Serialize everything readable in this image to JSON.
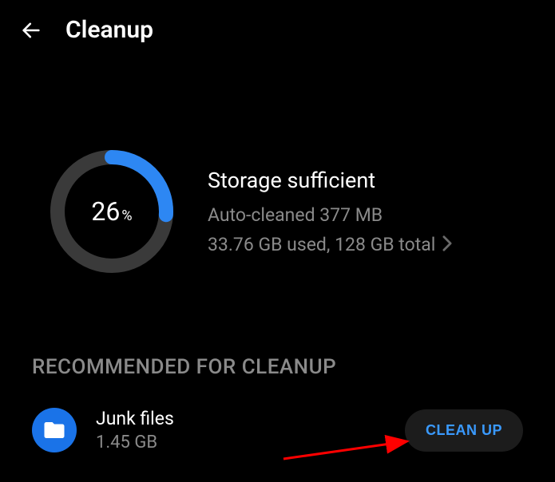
{
  "header": {
    "title": "Cleanup"
  },
  "storage": {
    "percentage": "26",
    "percent_symbol": "%",
    "status_title": "Storage sufficient",
    "auto_cleaned": "Auto-cleaned 377 MB",
    "usage_detail": "33.76 GB used, 128 GB total",
    "ring_color": "#2d87f3",
    "ring_bg": "#3a3a3a"
  },
  "recommended": {
    "section_label": "RECOMMENDED FOR CLEANUP",
    "items": [
      {
        "title": "Junk files",
        "size": "1.45 GB",
        "action_label": "CLEAN UP"
      }
    ]
  },
  "colors": {
    "accent": "#1a73e8",
    "button_text": "#3a9aff"
  }
}
